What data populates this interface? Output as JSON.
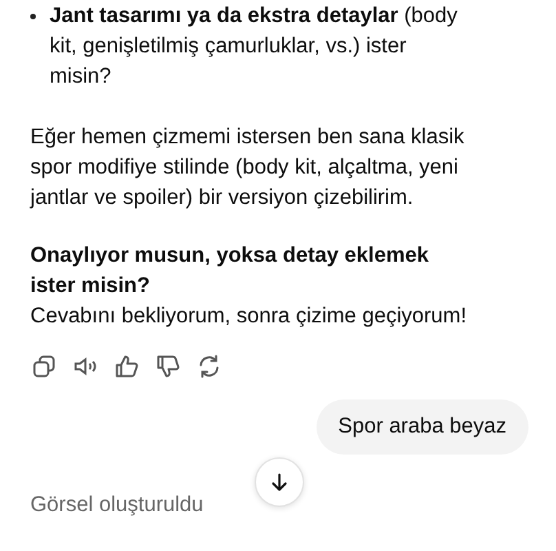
{
  "assistant_message": {
    "bullets": [
      "**Jant tasarımı ya da ekstra detaylar** (body kit, genişletilmiş çamurluklar, vs.) ister misin?"
    ],
    "paragraph": "Eğer hemen çizmemi istersen ben sana klasik spor modifiye stilinde (body kit, alçaltma, yeni jantlar ve spoiler) bir versiyon çizebilirim.",
    "question": "Onaylıyor musun, yoksa detay eklemek ister misin?",
    "closing": "Cevabını bekliyorum, sonra çizime geçiyorum!",
    "actions": [
      {
        "kind": "copy"
      },
      {
        "kind": "speak"
      },
      {
        "kind": "like"
      },
      {
        "kind": "dislike"
      },
      {
        "kind": "regenerate"
      }
    ]
  },
  "user_message": {
    "text": "Spor araba beyaz"
  },
  "status": "Görsel oluşturuldu"
}
